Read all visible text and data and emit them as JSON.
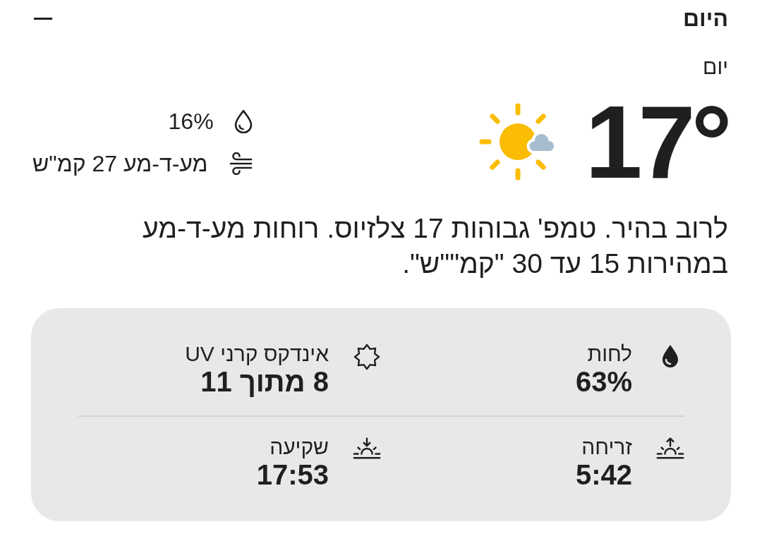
{
  "header": {
    "title": "היום"
  },
  "period": "יום",
  "current": {
    "temperature": "17°",
    "stats": [
      {
        "kind": "precipitation",
        "text": "16%"
      },
      {
        "kind": "wind",
        "text": "מע-ד-מע 27 קמ\"ש"
      }
    ]
  },
  "description": "לרוב בהיר. טמפ' גבוהות 17 צלזיוס. רוחות מע-ד-מע במהירות 15 עד 30 \"קמ\"\"ש\".",
  "details": [
    {
      "kind": "humidity",
      "label": "לחות",
      "value": "63%"
    },
    {
      "kind": "uv",
      "label": "אינדקס קרני UV",
      "value": "8 מתוך 11"
    },
    {
      "kind": "sunrise",
      "label": "זריחה",
      "value": "5:42"
    },
    {
      "kind": "sunset",
      "label": "שקיעה",
      "value": "17:53"
    }
  ]
}
